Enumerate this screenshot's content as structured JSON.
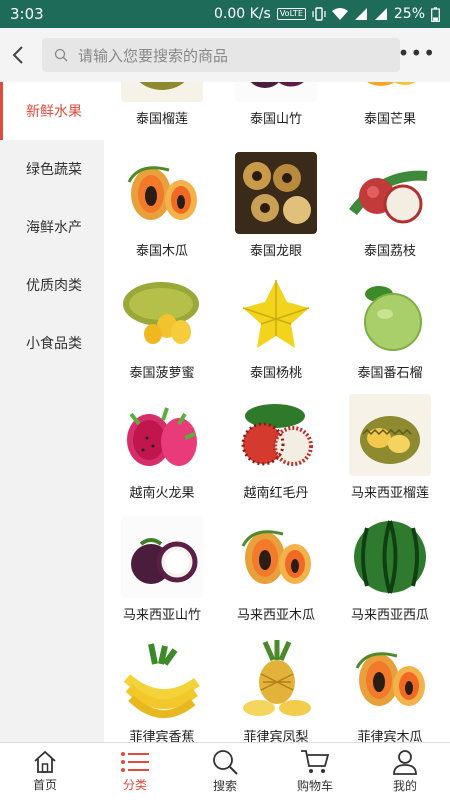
{
  "status_bar": {
    "time": "3:03",
    "speed": "0.00 K/s",
    "volte": "VoLTE",
    "battery": "25%"
  },
  "header": {
    "search_placeholder": "请输入您要搜索的商品"
  },
  "sidebar": {
    "categories": [
      {
        "label": "新鲜水果",
        "active": true
      },
      {
        "label": "绿色蔬菜"
      },
      {
        "label": "海鲜水产"
      },
      {
        "label": "优质肉类"
      },
      {
        "label": "小食品类"
      }
    ]
  },
  "products": [
    {
      "name": "泰国榴莲",
      "icon": "durian"
    },
    {
      "name": "泰国山竹",
      "icon": "mangosteen"
    },
    {
      "name": "泰国芒果",
      "icon": "mango"
    },
    {
      "name": "泰国木瓜",
      "icon": "papaya"
    },
    {
      "name": "泰国龙眼",
      "icon": "longan"
    },
    {
      "name": "泰国荔枝",
      "icon": "lychee"
    },
    {
      "name": "泰国菠萝蜜",
      "icon": "jackfruit"
    },
    {
      "name": "泰国杨桃",
      "icon": "starfruit"
    },
    {
      "name": "泰国番石榴",
      "icon": "guava"
    },
    {
      "name": "越南火龙果",
      "icon": "dragonfruit"
    },
    {
      "name": "越南红毛丹",
      "icon": "rambutan"
    },
    {
      "name": "马来西亚榴莲",
      "icon": "durian"
    },
    {
      "name": "马来西亚山竹",
      "icon": "mangosteen"
    },
    {
      "name": "马来西亚木瓜",
      "icon": "papaya"
    },
    {
      "name": "马来西亚西瓜",
      "icon": "watermelon"
    },
    {
      "name": "菲律宾香蕉",
      "icon": "banana"
    },
    {
      "name": "菲律宾凤梨",
      "icon": "pineapple"
    },
    {
      "name": "菲律宾木瓜",
      "icon": "papaya"
    }
  ],
  "tabbar": {
    "tabs": [
      {
        "label": "首页",
        "icon": "home-icon"
      },
      {
        "label": "分类",
        "icon": "list-icon",
        "active": true
      },
      {
        "label": "搜索",
        "icon": "search-icon"
      },
      {
        "label": "购物车",
        "icon": "cart-icon"
      },
      {
        "label": "我的",
        "icon": "user-icon"
      }
    ]
  },
  "colors": {
    "status_bar": "#1f6b59",
    "accent": "#e04b3d"
  }
}
